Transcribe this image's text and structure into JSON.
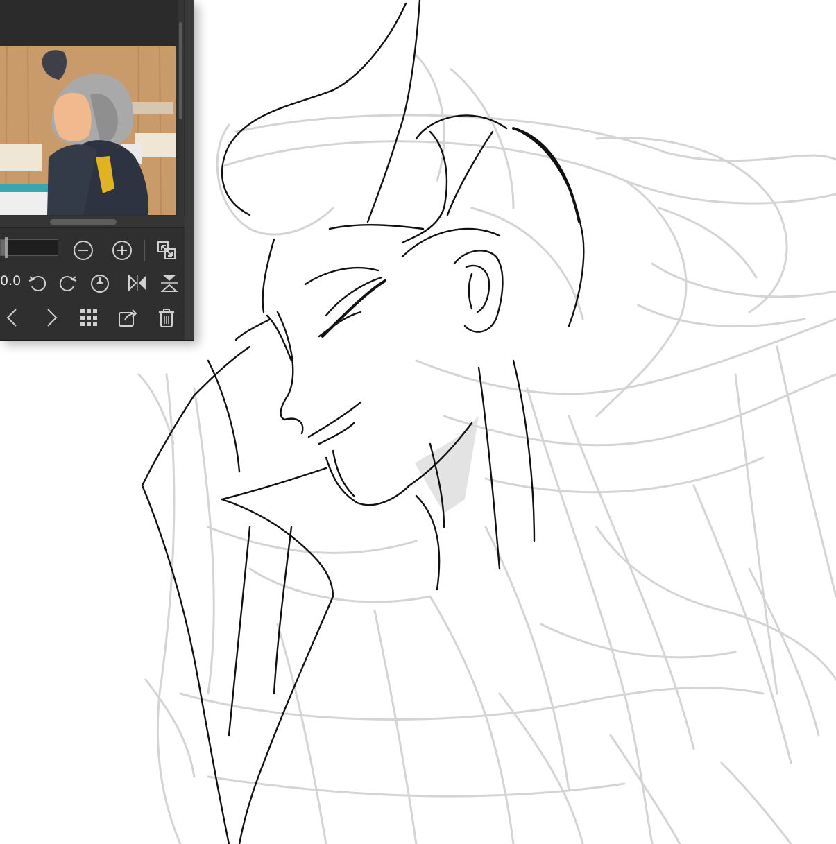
{
  "navigator": {
    "rotation_value": "0.0",
    "icons": {
      "zoom_out": "zoom-out-icon",
      "zoom_in": "zoom-in-icon",
      "fit": "fit-to-screen-icon",
      "rotate_left": "rotate-left-icon",
      "rotate_right": "rotate-right-icon",
      "reset_rotation": "reset-rotation-icon",
      "flip_horizontal": "flip-horizontal-icon",
      "flip_vertical": "flip-vertical-icon",
      "prev": "chevron-left-icon",
      "next": "chevron-right-icon",
      "grid": "grid-icon",
      "export": "export-icon",
      "delete": "trash-icon"
    }
  },
  "colors": {
    "panel_bg": "#2f2f2f",
    "icon": "#d0d0d0",
    "canvas_bg": "#ffffff",
    "ink_dark": "#111111",
    "ink_light": "#cfcfcf"
  }
}
